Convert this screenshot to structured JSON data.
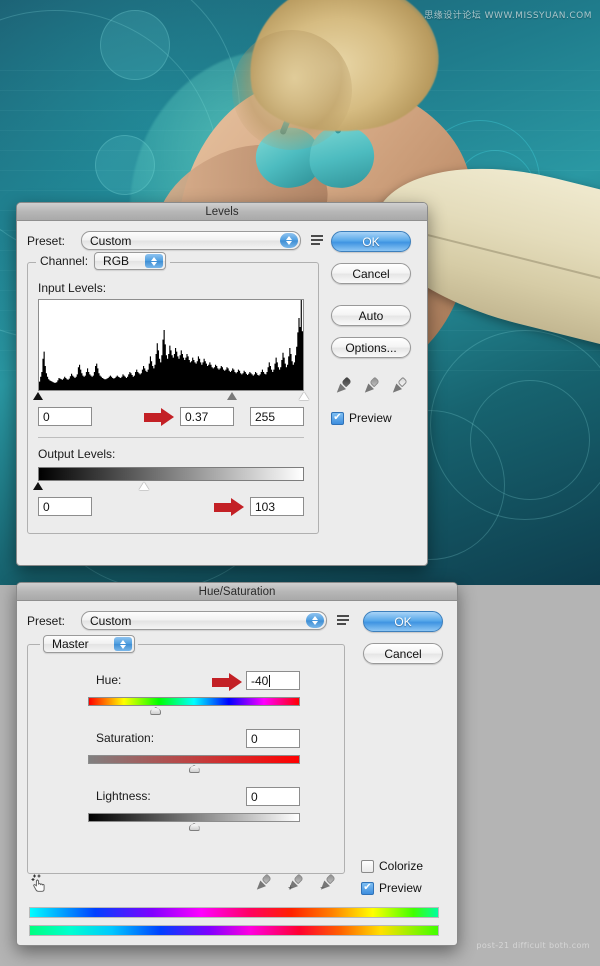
{
  "background": {
    "watermark_top": "思缘设计论坛  WWW.MISSYUAN.COM",
    "watermark_bottom": "post-21 difficult both.com",
    "description": "Teal abstract surf poster with blonde woman in turquoise bikini and cream surfboard"
  },
  "levels_dialog": {
    "title": "Levels",
    "preset_label": "Preset:",
    "preset_value": "Custom",
    "preset_menu_icon": "preset-options-icon",
    "channel_label": "Channel:",
    "channel_value": "RGB",
    "input_levels_label": "Input Levels:",
    "input_shadow": "0",
    "input_midtone": "0.37",
    "input_highlight": "255",
    "output_levels_label": "Output Levels:",
    "output_shadow": "0",
    "output_highlight": "103",
    "buttons": {
      "ok": "OK",
      "cancel": "Cancel",
      "auto": "Auto",
      "options": "Options..."
    },
    "eyedroppers": [
      "black-point-eyedropper",
      "gray-point-eyedropper",
      "white-point-eyedropper"
    ],
    "preview_label": "Preview",
    "preview_checked": true,
    "slider_positions": {
      "shadow_pct": 0,
      "midtone_pct": 73,
      "highlight_pct": 100,
      "output_shadow_pct": 0,
      "output_highlight_pct": 40
    },
    "histogram": [
      14,
      22,
      30,
      52,
      64,
      40,
      28,
      22,
      18,
      16,
      15,
      14,
      13,
      12,
      12,
      13,
      16,
      20,
      19,
      18,
      17,
      19,
      22,
      20,
      18,
      17,
      19,
      23,
      27,
      24,
      22,
      20,
      22,
      26,
      38,
      42,
      34,
      28,
      24,
      22,
      24,
      30,
      36,
      30,
      26,
      24,
      22,
      24,
      30,
      40,
      44,
      36,
      28,
      24,
      22,
      20,
      19,
      18,
      18,
      19,
      20,
      22,
      24,
      22,
      20,
      19,
      20,
      22,
      24,
      22,
      21,
      20,
      22,
      26,
      24,
      22,
      20,
      22,
      26,
      30,
      28,
      25,
      22,
      24,
      30,
      34,
      30,
      28,
      26,
      28,
      34,
      40,
      36,
      32,
      30,
      34,
      44,
      56,
      48,
      40,
      36,
      42,
      60,
      78,
      66,
      52,
      46,
      58,
      84,
      100,
      76,
      58,
      52,
      60,
      74,
      66,
      58,
      54,
      60,
      70,
      64,
      56,
      52,
      58,
      66,
      60,
      54,
      50,
      54,
      60,
      56,
      50,
      46,
      48,
      54,
      50,
      46,
      44,
      48,
      56,
      52,
      46,
      42,
      46,
      52,
      48,
      44,
      40,
      42,
      46,
      42,
      38,
      36,
      38,
      42,
      40,
      36,
      34,
      36,
      40,
      38,
      34,
      32,
      34,
      38,
      36,
      32,
      30,
      32,
      36,
      34,
      30,
      28,
      30,
      34,
      32,
      28,
      26,
      28,
      32,
      30,
      27,
      25,
      27,
      30,
      28,
      26,
      24,
      26,
      30,
      28,
      25,
      24,
      26,
      30,
      34,
      30,
      27,
      26,
      30,
      38,
      46,
      40,
      34,
      30,
      34,
      44,
      54,
      46,
      38,
      34,
      38,
      50,
      62,
      54,
      44,
      38,
      42,
      56,
      70,
      60,
      48,
      42,
      46,
      58,
      72,
      96,
      120,
      105,
      150,
      98
    ]
  },
  "hue_saturation_dialog": {
    "title": "Hue/Saturation",
    "preset_label": "Preset:",
    "preset_value": "Custom",
    "preset_menu_icon": "preset-options-icon",
    "channel_value": "Master",
    "hue_label": "Hue:",
    "hue_value": "-40",
    "hue_slider_pct": 32,
    "saturation_label": "Saturation:",
    "saturation_value": "0",
    "saturation_slider_pct": 50,
    "lightness_label": "Lightness:",
    "lightness_value": "0",
    "lightness_slider_pct": 50,
    "colorize_label": "Colorize",
    "colorize_checked": false,
    "preview_label": "Preview",
    "preview_checked": true,
    "buttons": {
      "ok": "OK",
      "cancel": "Cancel"
    },
    "on_image_tool_icon": "on-image-adjustment-icon",
    "eyedroppers": [
      "sample-eyedropper",
      "add-to-sample-eyedropper",
      "subtract-from-sample-eyedropper"
    ]
  },
  "colors": {
    "accent_blue": "#3f94e2",
    "arrow_red": "#c32025",
    "dialog_bg": "#ececec",
    "desktop_grey": "#b4b4b4"
  }
}
